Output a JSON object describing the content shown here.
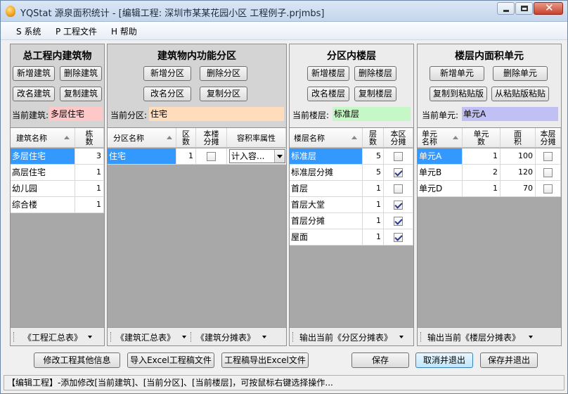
{
  "window": {
    "title": "YQStat 源泉面积统计 - [编辑工程: 深圳市某某花园小区 工程例子.prjmbs]"
  },
  "menu": [
    {
      "label": "S 系统"
    },
    {
      "label": "P 工程文件"
    },
    {
      "label": "H 帮助"
    }
  ],
  "buildings_panel": {
    "title": "总工程内建筑物",
    "buttons": {
      "add": "新增建筑",
      "delete": "删除建筑",
      "rename": "改名建筑",
      "copy": "复制建筑"
    },
    "current_label": "当前建筑:",
    "current_value": "多层住宅",
    "current_color": "#ffc8c8",
    "columns": {
      "name": "建筑名称",
      "count": "栋\n数"
    },
    "rows": [
      {
        "name": "多层住宅",
        "count": "3"
      },
      {
        "name": "高层住宅",
        "count": "1"
      },
      {
        "name": "幼儿园",
        "count": "1"
      },
      {
        "name": "综合楼",
        "count": "1"
      }
    ],
    "footer": "《工程汇总表》"
  },
  "zones_panel": {
    "title": "建筑物内功能分区",
    "buttons": {
      "add": "新增分区",
      "delete": "删除分区",
      "rename": "改名分区",
      "copy": "复制分区"
    },
    "current_label": "当前分区:",
    "current_value": "住宅",
    "current_color": "#ffdcbc",
    "columns": {
      "name": "分区名称",
      "count": "区\n数",
      "share": "本楼\n分摊",
      "far": "容积率属性"
    },
    "rows": [
      {
        "name": "住宅",
        "count": "1",
        "share": false,
        "far": "计入容..."
      }
    ],
    "footer_left": "《建筑汇总表》",
    "footer_right": "《建筑分摊表》"
  },
  "floors_panel": {
    "title": "分区内楼层",
    "buttons": {
      "add": "新增楼层",
      "delete": "删除楼层",
      "rename": "改名楼层",
      "copy": "复制楼层"
    },
    "current_label": "当前楼层:",
    "current_value": "标准层",
    "current_color": "#c6f7c6",
    "columns": {
      "name": "楼层名称",
      "count": "层\n数",
      "share": "本区\n分摊"
    },
    "rows": [
      {
        "name": "标准层",
        "count": "5",
        "share": false
      },
      {
        "name": "标准层分摊",
        "count": "5",
        "share": true
      },
      {
        "name": "首层",
        "count": "1",
        "share": false
      },
      {
        "name": "首层大堂",
        "count": "1",
        "share": true
      },
      {
        "name": "首层分摊",
        "count": "1",
        "share": true
      },
      {
        "name": "屋面",
        "count": "1",
        "share": true
      }
    ],
    "footer": "输出当前《分区分摊表》"
  },
  "units_panel": {
    "title": "楼层内面积单元",
    "buttons": {
      "add": "新增单元",
      "delete": "删除单元",
      "copy_to_clip": "复制到粘贴版",
      "paste_from_clip": "从粘贴版粘贴"
    },
    "current_label": "当前单元:",
    "current_value": "单元A",
    "current_color": "#c0c0f4",
    "columns": {
      "name": "单元\n名称",
      "count": "单元\n数",
      "area": "面\n积",
      "share": "本层\n分摊"
    },
    "rows": [
      {
        "name": "单元A",
        "count": "1",
        "area": "100",
        "share": false
      },
      {
        "name": "单元B",
        "count": "2",
        "area": "120",
        "share": false
      },
      {
        "name": "单元D",
        "count": "1",
        "area": "70",
        "share": false
      }
    ],
    "footer": "输出当前《楼层分摊表》"
  },
  "bottom_buttons": {
    "edit_info": "修改工程其他信息",
    "import_excel": "导入Excel工程稿文件",
    "export_excel": "工程稿导出Excel文件",
    "save": "保存",
    "cancel_exit": "取消并退出",
    "save_exit": "保存并退出"
  },
  "status": "【编辑工程】-添加修改[当前建筑]、[当前分区]、[当前楼层]，可按鼠标右键选择操作..."
}
